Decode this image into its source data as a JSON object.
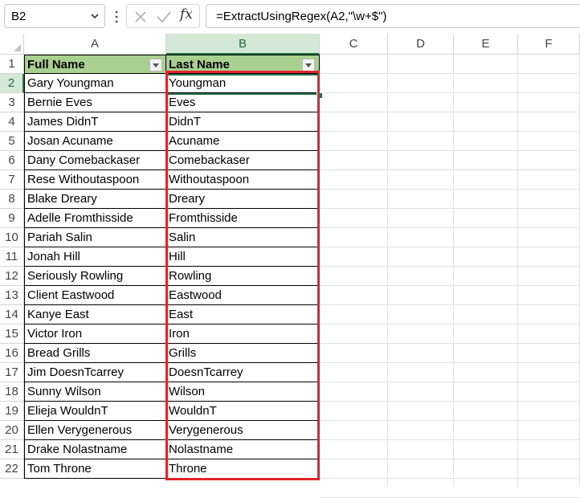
{
  "formula_bar": {
    "name_box": "B2",
    "formula": "=ExtractUsingRegex(A2,\"\\w+$\")",
    "fx_label": "fx"
  },
  "columns": [
    "A",
    "B",
    "C",
    "D",
    "E",
    "F"
  ],
  "selected_column": "B",
  "selected_row": 2,
  "table": {
    "headers": [
      "Full Name",
      "Last Name"
    ],
    "rows": [
      [
        "Gary Youngman",
        "Youngman"
      ],
      [
        "Bernie Eves",
        "Eves"
      ],
      [
        "James DidnT",
        "DidnT"
      ],
      [
        "Josan Acuname",
        "Acuname"
      ],
      [
        "Dany Comebackaser",
        "Comebackaser"
      ],
      [
        "Rese Withoutaspoon",
        "Withoutaspoon"
      ],
      [
        "Blake Dreary",
        "Dreary"
      ],
      [
        "Adelle Fromthisside",
        "Fromthisside"
      ],
      [
        "Pariah Salin",
        "Salin"
      ],
      [
        "Jonah Hill",
        "Hill"
      ],
      [
        "Seriously Rowling",
        "Rowling"
      ],
      [
        "Client Eastwood",
        "Eastwood"
      ],
      [
        "Kanye East",
        "East"
      ],
      [
        "Victor Iron",
        "Iron"
      ],
      [
        "Bread Grills",
        "Grills"
      ],
      [
        "Jim DoesnTcarrey",
        "DoesnTcarrey"
      ],
      [
        "Sunny Wilson",
        "Wilson"
      ],
      [
        "Elieja WouldnT",
        "WouldnT"
      ],
      [
        "Ellen Verygenerous",
        "Verygenerous"
      ],
      [
        "Drake Nolastname",
        "Nolastname"
      ],
      [
        "Tom Throne",
        "Throne"
      ]
    ]
  },
  "colors": {
    "header_fill": "#a9d08e",
    "selection_accent": "#217346",
    "highlight_border": "#e3242b"
  },
  "icons": {
    "cancel": "close-icon",
    "enter": "check-icon",
    "function": "fx-icon",
    "name_box_dropdown": "chevron-down-icon",
    "filter": "filter-dropdown-icon"
  }
}
